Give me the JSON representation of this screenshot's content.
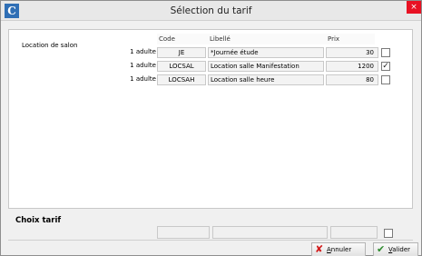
{
  "window": {
    "title": "Sélection du tarif",
    "app_icon": "C",
    "close_symbol": "×"
  },
  "section_label": "Location de salon",
  "table": {
    "headers": {
      "code": "Code",
      "libelle": "Libellé",
      "prix": "Prix"
    },
    "rows": [
      {
        "qty": "1 adulte",
        "code": "JE",
        "libelle": "*Journée étude",
        "prix": "30",
        "checked": ""
      },
      {
        "qty": "1 adulte",
        "code": "LOCSAL",
        "libelle": "Location salle Manifestation",
        "prix": "1200",
        "checked": "✓"
      },
      {
        "qty": "1 adulte",
        "code": "LOCSAH",
        "libelle": "Location salle heure",
        "prix": "80",
        "checked": ""
      }
    ]
  },
  "choix": {
    "label": "Choix tarif"
  },
  "buttons": {
    "cancel": {
      "first": "A",
      "rest": "nnuler",
      "icon": "✘"
    },
    "validate": {
      "first": "V",
      "rest": "alider",
      "icon": "✔"
    }
  }
}
